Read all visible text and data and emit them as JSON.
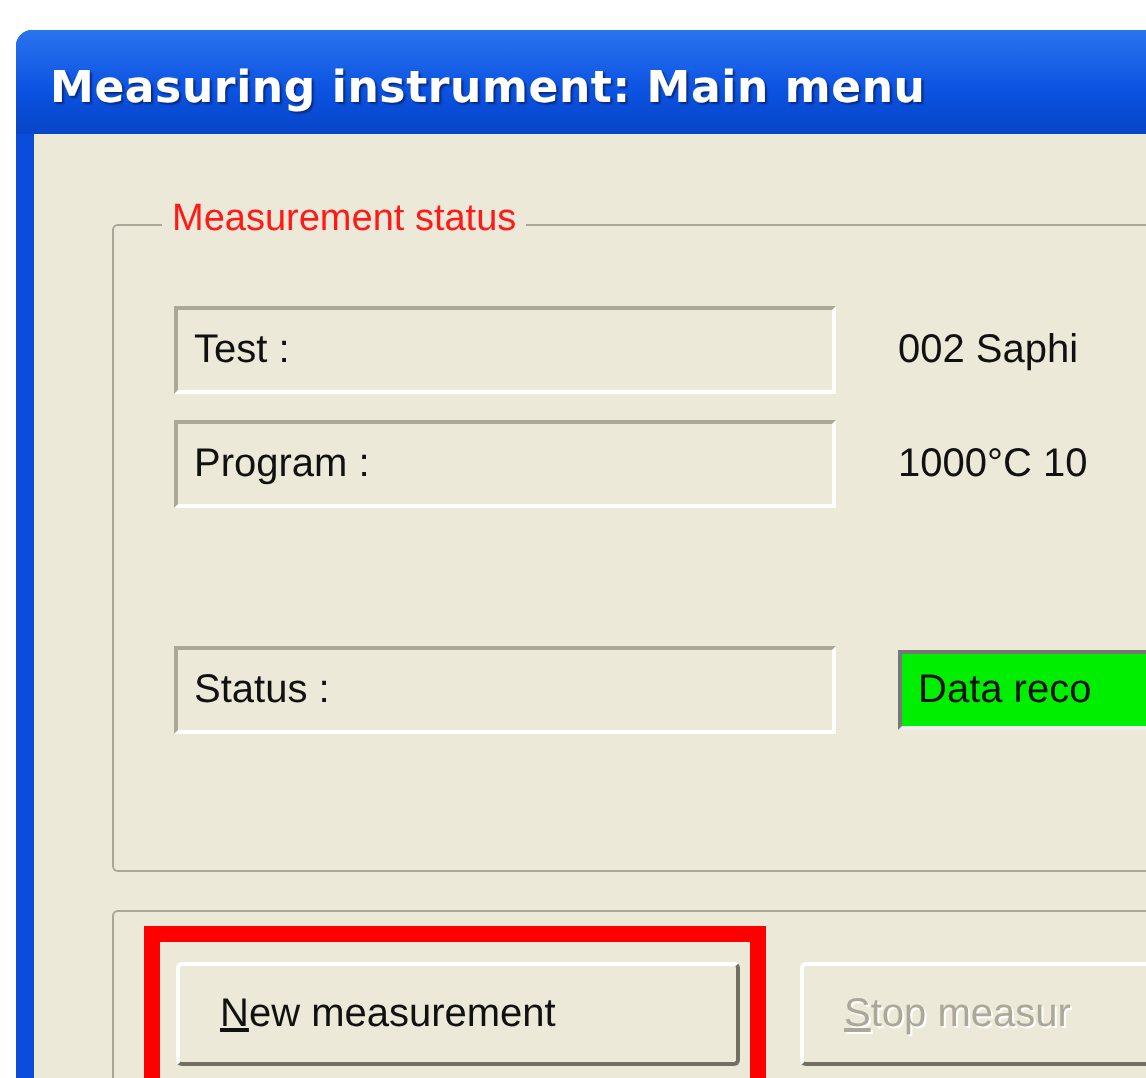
{
  "window": {
    "title": "Measuring instrument: Main menu"
  },
  "measurement_status": {
    "title": "Measurement status",
    "fields": [
      {
        "label": "Test :",
        "value": "002 Saphi",
        "kind": "text"
      },
      {
        "label": "Program :",
        "value": "1000°C 10",
        "kind": "text"
      },
      {
        "label": "Status :",
        "value": "Data reco",
        "kind": "indicator"
      }
    ]
  },
  "buttons": [
    {
      "label": "New measurement",
      "disabled": false,
      "highlighted": true
    },
    {
      "label": "Stop measur",
      "disabled": true,
      "highlighted": false
    }
  ]
}
